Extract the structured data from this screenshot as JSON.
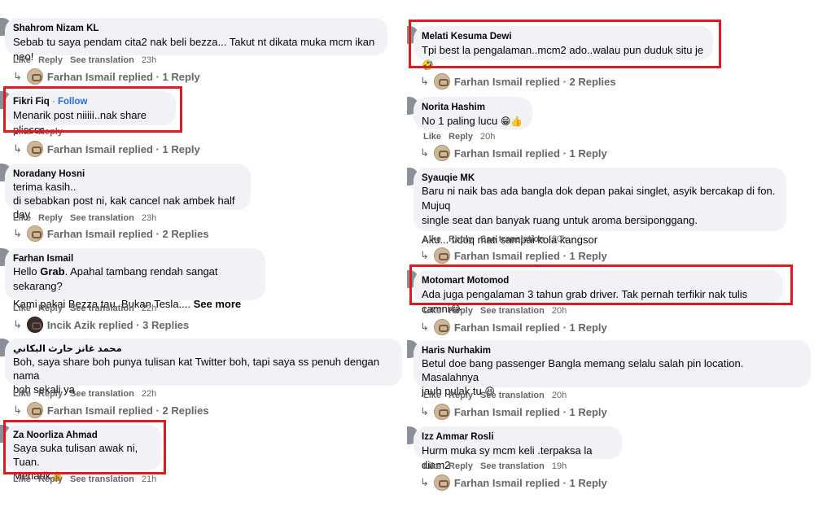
{
  "labels": {
    "like": "Like",
    "reply": "Reply",
    "see_translation": "See translation",
    "see_more": "See more",
    "follow": "Follow",
    "dot": "·"
  },
  "left": [
    {
      "name": "Shahrom Nizam KL",
      "lines": [
        "Sebab tu saya pendam cita2 nak beli bezza... Takut nt dikata muka mcm ikan neo!"
      ],
      "time": "23h",
      "replies": "Farhan Ismail replied · 1 Reply"
    },
    {
      "name": "Fikri Fiq",
      "lines": [
        "Menarik post niiiii..nak share plissss"
      ],
      "replies": "Farhan Ismail replied · 1 Reply"
    },
    {
      "name": "Noradany Hosni",
      "lines": [
        "terima kasih..",
        "di sebabkan post ni, kak cancel nak ambek half day"
      ],
      "time": "23h",
      "replies": "Farhan Ismail replied · 2 Replies"
    },
    {
      "name": "Farhan Ismail",
      "line1_a": "Hello ",
      "line1_b": "Grab",
      "line1_c": ". Apahal tambang rendah sangat sekarang?",
      "line2": "Kami pakai Bezza tau. Bukan Tesla.... ",
      "time": "22h",
      "replies": "Incik Azik replied · 3 Replies"
    },
    {
      "name": "محمد غانز حارث البكاني",
      "lines": [
        "Boh, saya share boh punya tulisan kat Twitter boh, tapi saya ss penuh dengan nama",
        "boh sekali ya"
      ],
      "time": "22h",
      "replies": "Farhan Ismail replied · 2 Replies"
    },
    {
      "name": "Za Noorliza Ahmad",
      "lines": [
        "Saya suka tulisan awak ni, Tuan.",
        "Menarik"
      ],
      "emoji": "👍",
      "time": "21h"
    }
  ],
  "right": [
    {
      "name": "Melati Kesuma Dewi",
      "lines": [
        "Tpi best la pengalaman..mcm2 ado..walau pun duduk situ je "
      ],
      "emoji": "🤣",
      "replies": "Farhan Ismail replied · 2 Replies"
    },
    {
      "name": "Norita Hashim",
      "lines": [
        "No 1 paling lucu "
      ],
      "emoji": "😁👍",
      "time": "20h",
      "replies": "Farhan Ismail replied · 1 Reply"
    },
    {
      "name": "Syauqie MK",
      "lines": [
        "Baru ni naik bas ada bangla dok depan pakai singlet, asyik bercakap di fon. Mujuq",
        "single seat dan banyak ruang untuk aroma bersiponggang."
      ],
      "para": "Aku... tidoq mati sampai kola kangsor",
      "time": "20h",
      "replies": "Farhan Ismail replied · 1 Reply"
    },
    {
      "name": "Motomart Motomod",
      "lines": [
        "Ada juga pengalaman 3 tahun grab driver. Tak pernah terfikir nak tulis camni"
      ],
      "emoji": "😂",
      "time": "20h",
      "replies": "Farhan Ismail replied · 1 Reply"
    },
    {
      "name": "Haris Nurhakim",
      "lines": [
        "Betul doe bang passenger Bangla memang selalu salah pin location. Masalahnya",
        "jauh pulak tu "
      ],
      "emoji": "😆",
      "time": "20h",
      "replies": "Farhan Ismail replied · 1 Reply"
    },
    {
      "name": "Izz Ammar Rosli",
      "lines": [
        "Hurm muka sy mcm keli .terpaksa la diam2"
      ],
      "time": "19h",
      "replies": "Farhan Ismail replied · 1 Reply"
    }
  ]
}
